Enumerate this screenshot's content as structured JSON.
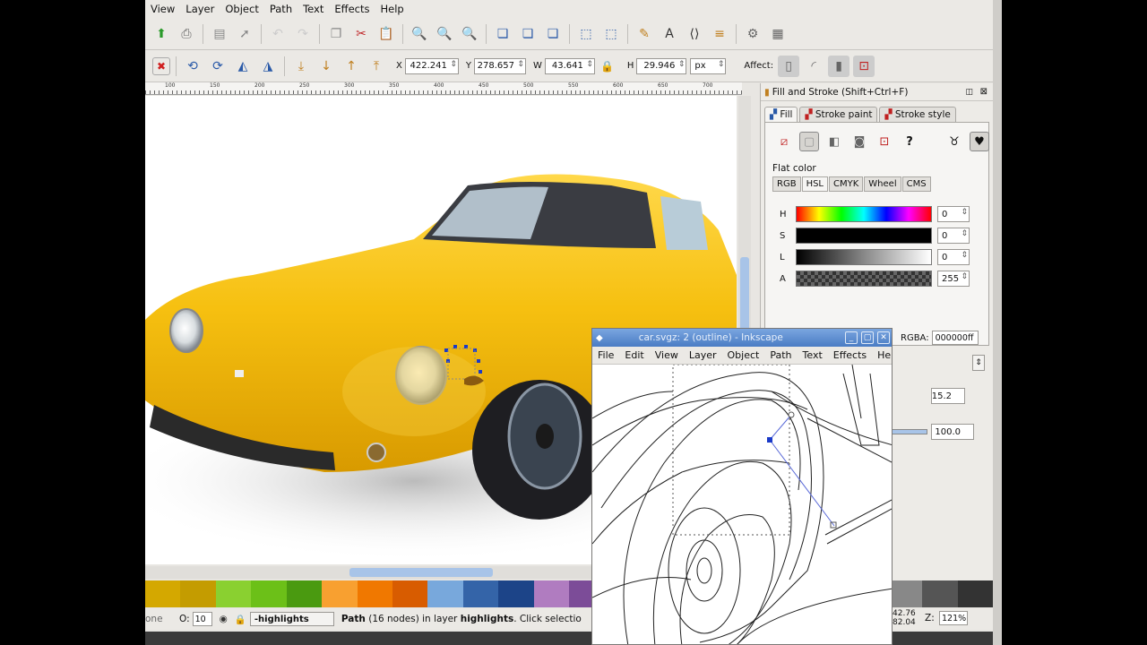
{
  "menu": [
    "View",
    "Layer",
    "Object",
    "Path",
    "Text",
    "Effects",
    "Help"
  ],
  "toolbar2": {
    "x_label": "X",
    "x_value": "422.241",
    "y_label": "Y",
    "y_value": "278.657",
    "w_label": "W",
    "w_value": "43.641",
    "h_label": "H",
    "h_value": "29.946",
    "unit": "px",
    "affect_label": "Affect:"
  },
  "ruler_ticks": [
    "100",
    "150",
    "200",
    "250",
    "300",
    "350",
    "400",
    "450",
    "500",
    "550",
    "600",
    "650",
    "700"
  ],
  "dock": {
    "title": "Fill and Stroke (Shift+Ctrl+F)",
    "tabs": [
      "Fill",
      "Stroke paint",
      "Stroke style"
    ],
    "flat_color": "Flat color",
    "color_tabs": [
      "RGB",
      "HSL",
      "CMYK",
      "Wheel",
      "CMS"
    ],
    "sliders": [
      {
        "label": "H",
        "value": "0"
      },
      {
        "label": "S",
        "value": "0"
      },
      {
        "label": "L",
        "value": "0"
      },
      {
        "label": "A",
        "value": "255"
      }
    ],
    "rgba_label": "RGBA:",
    "rgba_value": "000000ff",
    "blur_value": "15.2",
    "opacity_value": "100.0"
  },
  "outline_window": {
    "title": "car.svgz: 2 (outline) - Inkscape",
    "menu": [
      "File",
      "Edit",
      "View",
      "Layer",
      "Object",
      "Path",
      "Text",
      "Effects",
      "Help"
    ]
  },
  "palette": [
    "#d4a800",
    "#c49c00",
    "#8ad030",
    "#6cc018",
    "#4a9a10",
    "#f8a030",
    "#f07800",
    "#d85c00",
    "#78a8dc",
    "#3464a8",
    "#1c4488",
    "#b07cc0",
    "#7c4c98",
    "#5c2c78",
    "#ffffff",
    "#ffffff",
    "#ffffff",
    "#ffffff",
    "#ffffff",
    "#ffffff",
    "#ffffff",
    "#888888",
    "#555555",
    "#333333"
  ],
  "status": {
    "left_label": "one",
    "opacity_label": "O:",
    "opacity_value": "10",
    "layer": "-highlights",
    "message_prefix": "Path",
    "message_nodes": "(16 nodes) in layer",
    "message_layer": "highlights",
    "message_suffix": ". Click selectio",
    "coord_x": "42.76",
    "coord_y": "82.04",
    "zoom_label": "Z:",
    "zoom": "121%"
  }
}
